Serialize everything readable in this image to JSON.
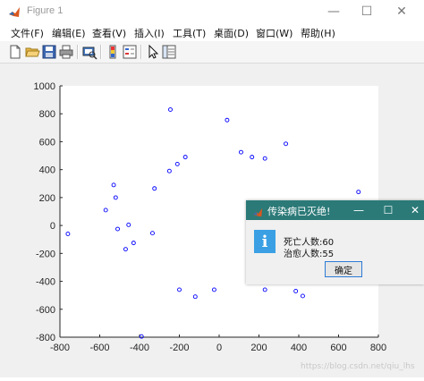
{
  "window": {
    "title": "Figure 1",
    "minimize_glyph": "—",
    "maximize_glyph": "☐",
    "close_glyph": "✕"
  },
  "menubar": {
    "items": [
      "文件(F)",
      "编辑(E)",
      "查看(V)",
      "插入(I)",
      "工具(T)",
      "桌面(D)",
      "窗口(W)",
      "帮助(H)"
    ]
  },
  "toolbar": {
    "icons": [
      "new-figure-icon",
      "open-file-icon",
      "save-icon",
      "print-icon",
      "print-preview-icon",
      "colorbar-icon",
      "legend-icon",
      "edit-plot-arrow-icon",
      "property-editor-icon"
    ]
  },
  "chart_data": {
    "type": "scatter",
    "marker": "circle",
    "marker_color": "#0000ff",
    "xlim": [
      -800,
      800
    ],
    "ylim": [
      -800,
      1000
    ],
    "xticks": [
      -800,
      -600,
      -400,
      -200,
      0,
      200,
      400,
      600,
      800
    ],
    "yticks": [
      -800,
      -600,
      -400,
      -200,
      0,
      200,
      400,
      600,
      800,
      1000
    ],
    "grid": false,
    "points": [
      {
        "x": -760,
        "y": -60
      },
      {
        "x": -570,
        "y": 110
      },
      {
        "x": -530,
        "y": 290
      },
      {
        "x": -520,
        "y": 200
      },
      {
        "x": -510,
        "y": -25
      },
      {
        "x": -470,
        "y": -170
      },
      {
        "x": -455,
        "y": 5
      },
      {
        "x": -430,
        "y": -125
      },
      {
        "x": -390,
        "y": -795
      },
      {
        "x": -335,
        "y": -55
      },
      {
        "x": -325,
        "y": 265
      },
      {
        "x": -250,
        "y": 390
      },
      {
        "x": -245,
        "y": 830
      },
      {
        "x": -210,
        "y": 440
      },
      {
        "x": -200,
        "y": -460
      },
      {
        "x": -170,
        "y": 490
      },
      {
        "x": -120,
        "y": -510
      },
      {
        "x": -25,
        "y": -460
      },
      {
        "x": 40,
        "y": 755
      },
      {
        "x": 110,
        "y": 525
      },
      {
        "x": 165,
        "y": 490
      },
      {
        "x": 230,
        "y": 480
      },
      {
        "x": 230,
        "y": -460
      },
      {
        "x": 335,
        "y": 585
      },
      {
        "x": 385,
        "y": -470
      },
      {
        "x": 420,
        "y": -505
      },
      {
        "x": 700,
        "y": 240
      }
    ]
  },
  "dialog": {
    "title": "传染病已灭绝!",
    "line1_label": "死亡人数:",
    "line1_value": "60",
    "line2_label": "治愈人数:",
    "line2_value": "55",
    "ok_label": "确定",
    "info_glyph": "i",
    "minimize_glyph": "—",
    "maximize_glyph": "☐",
    "close_glyph": "✕",
    "titlebar_color": "#2b7a78"
  },
  "watermark": "https://blog.csdn.net/qiu_lhs"
}
